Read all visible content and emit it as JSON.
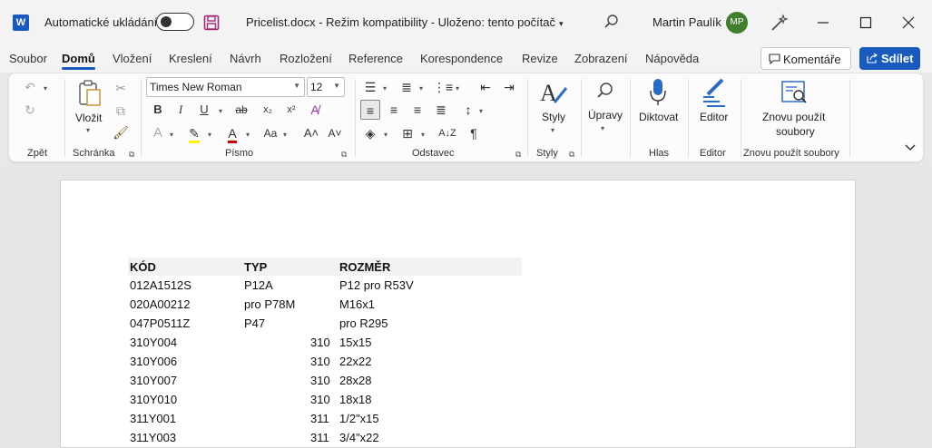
{
  "titlebar": {
    "app_logo": "W",
    "autosave_label": "Automatické ukládání",
    "autosave_state": "off",
    "document_title": "Pricelist.docx  -  Režim kompatibility  -  Uloženo: tento počítač",
    "user_name": "Martin Paulík",
    "user_initials": "MP",
    "colors": {
      "brand": "#185abd",
      "avatar": "#3f7e2a"
    }
  },
  "menubar": {
    "items": [
      "Soubor",
      "Domů",
      "Vložení",
      "Kreslení",
      "Návrh",
      "Rozložení",
      "Reference",
      "Korespondence",
      "Revize",
      "Zobrazení",
      "Nápověda"
    ],
    "active": "Domů",
    "comments_label": "Komentáře",
    "share_label": "Sdílet"
  },
  "ribbon": {
    "groups": {
      "undo": "Zpět",
      "clipboard": "Schránka",
      "font": "Písmo",
      "paragraph": "Odstavec",
      "styles": "Styly",
      "voice": "Hlas",
      "editor": "Editor",
      "reuse": "Znovu použít soubory"
    },
    "paste_label": "Vložit",
    "font_name": "Times New Roman",
    "font_size": "12",
    "styles_label": "Styly",
    "editing_label": "Úpravy",
    "dictate_label": "Diktovat",
    "editor_label": "Editor",
    "reuse_label_1": "Znovu použít",
    "reuse_label_2": "soubory"
  },
  "document": {
    "headers": [
      "KÓD",
      "TYP",
      "ROZMĚR"
    ],
    "rows": [
      {
        "kod": "012A1512S",
        "typ": "P12A",
        "typ_align": "left",
        "rozmer": "P12 pro R53V"
      },
      {
        "kod": "020A00212",
        "typ": "pro P78M",
        "typ_align": "left",
        "rozmer": "M16x1"
      },
      {
        "kod": "047P0511Z",
        "typ": "P47",
        "typ_align": "left",
        "rozmer": "pro R295"
      },
      {
        "kod": "310Y004",
        "typ": "310",
        "typ_align": "right",
        "rozmer": "15x15"
      },
      {
        "kod": "310Y006",
        "typ": "310",
        "typ_align": "right",
        "rozmer": "22x22"
      },
      {
        "kod": "310Y007",
        "typ": "310",
        "typ_align": "right",
        "rozmer": "28x28"
      },
      {
        "kod": "310Y010",
        "typ": "310",
        "typ_align": "right",
        "rozmer": "18x18"
      },
      {
        "kod": "311Y001",
        "typ": "311",
        "typ_align": "right",
        "rozmer": "1/2\"x15"
      },
      {
        "kod": "311Y003",
        "typ": "311",
        "typ_align": "right",
        "rozmer": "3/4\"x22"
      }
    ]
  }
}
